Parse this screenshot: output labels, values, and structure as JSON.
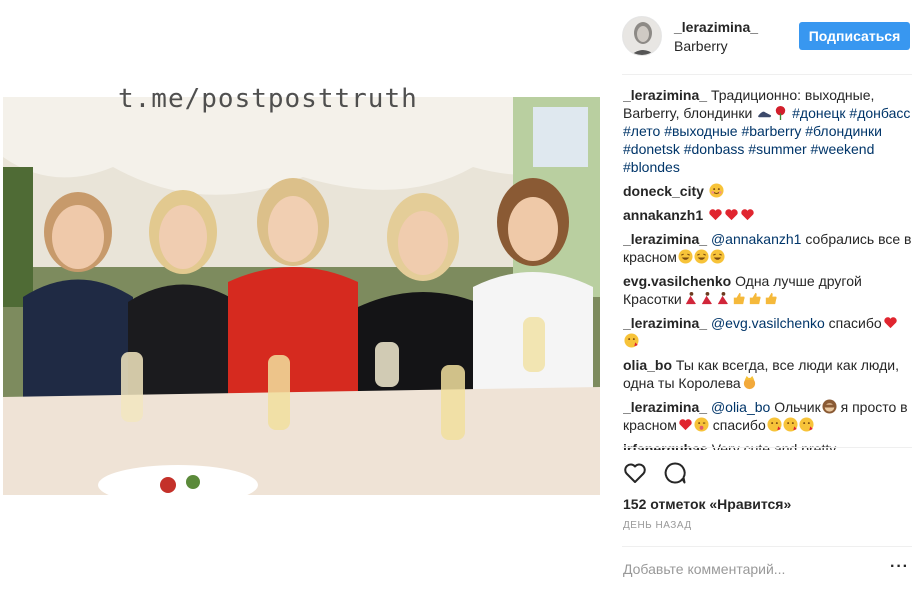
{
  "photo": {
    "watermark": "t.me/postposttruth"
  },
  "post_header": {
    "username": "_lerazimina_",
    "location": "Barberry",
    "follow_label": "Подписаться"
  },
  "comments": [
    {
      "user": "_lerazimina_",
      "text": "Традиционно: выходные, Barberry, блондинки",
      "hashtags": "#донецк #донбасс #лето #выходные #barberry #блондинки #donetsk #donbass #summer #weekend #blondes"
    },
    {
      "user": "doneck_city",
      "text": ""
    },
    {
      "user": "annakanzh1",
      "text": ""
    },
    {
      "user": "_lerazimina_",
      "mention": "@annakanzh1",
      "text": "собрались все в красном"
    },
    {
      "user": "evg.vasilchenko",
      "text": "Одна лучше другой Красотки"
    },
    {
      "user": "_lerazimina_",
      "mention": "@evg.vasilchenko",
      "text": "спасибо"
    },
    {
      "user": "olia_bo",
      "text": "Ты как всегда, все люди как люди, одна ты Королева"
    },
    {
      "user": "_lerazimina_",
      "mention": "@olia_bo",
      "text": "Ольчик",
      "text2": "я просто в красном",
      "text3": "спасибо"
    },
    {
      "user": "irfanerguhas",
      "text": "Very cute and pretty"
    }
  ],
  "actions": {
    "like_icon": "heart-icon",
    "comment_icon": "comment-bubble-icon"
  },
  "likes_text": "152 отметок «Нравится»",
  "time_text": "день назад",
  "comment_input": {
    "placeholder": "Добавьте комментарий..."
  },
  "more_label": "···",
  "colors": {
    "follow_button": "#3897f0",
    "link": "#003569",
    "heart": "#ed4956"
  }
}
